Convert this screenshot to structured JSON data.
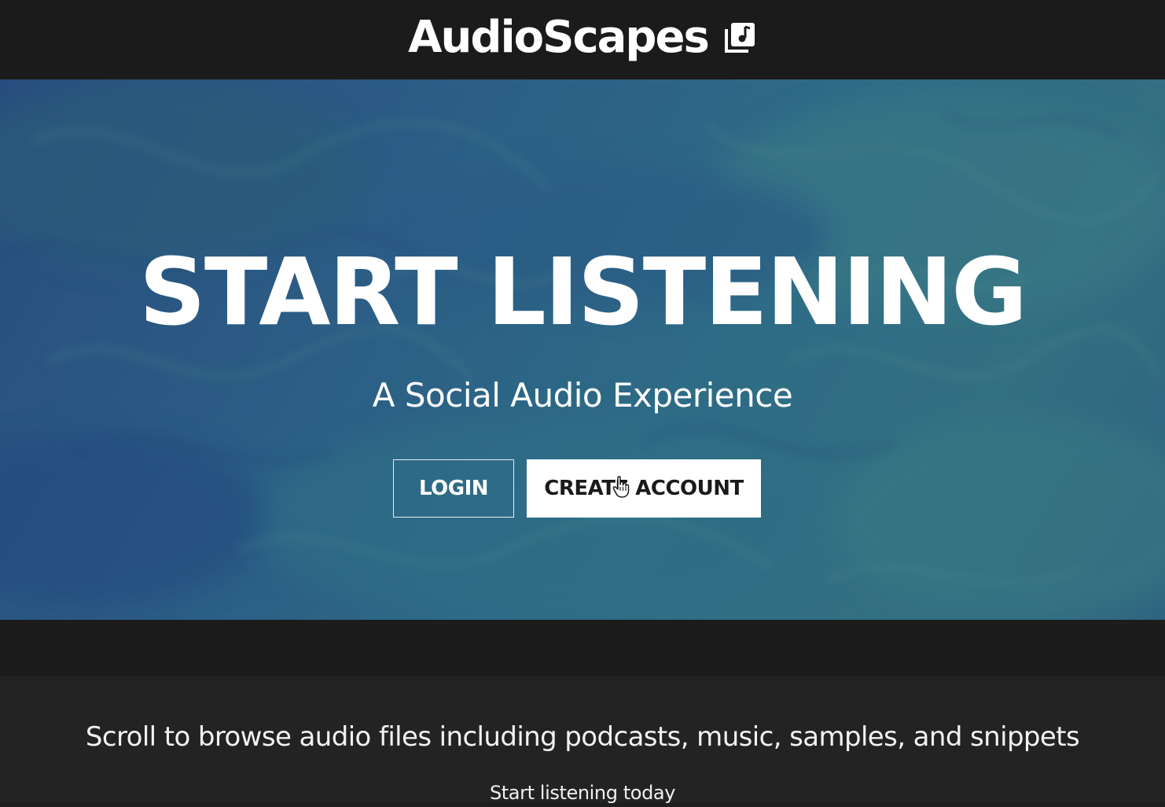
{
  "header": {
    "brand_title": "AudioScapes",
    "brand_icon": "music-library-icon"
  },
  "hero": {
    "title": "START LISTENING",
    "subtitle": "A Social Audio Experience",
    "login_label": "LOGIN",
    "create_account_label": "CREATE ACCOUNT"
  },
  "info": {
    "text": "Scroll to browse audio files including podcasts, music, samples, and snippets",
    "subtext": "Start listening today"
  },
  "colors": {
    "header_bg": "#1b1b1b",
    "hero_blue": "#2c5f86",
    "hero_teal": "#326f82",
    "page_bg": "#232323",
    "text": "#ffffff"
  },
  "icons": {
    "cursor": "hand-pointer-icon"
  }
}
